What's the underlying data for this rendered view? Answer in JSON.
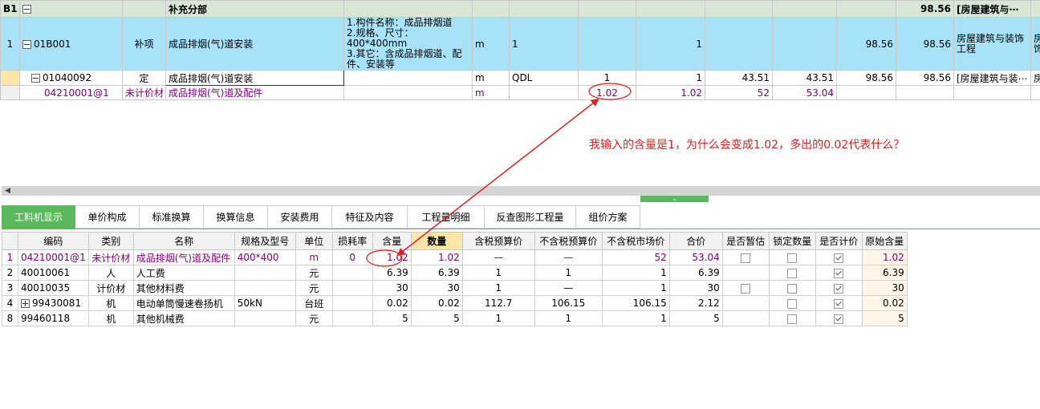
{
  "top": {
    "section_row": {
      "row_label": "B1",
      "name": "补充分部",
      "total": "98.56",
      "major": "[房屋建筑与⋯"
    },
    "rows": [
      {
        "num": "1",
        "code": "01B001",
        "type": "补项",
        "name": "成品排烟(气)道安装",
        "features": "1.构件名称：成品排烟道\n2.规格、尺寸：400*400mm\n3.其它：含成品排烟道、配件、安装等",
        "unit": "m",
        "expr": "1",
        "content": "",
        "qty": "1",
        "price": "",
        "combined": "",
        "unit_price": "98.56",
        "total": "98.56",
        "major": "房屋建筑与装饰工程",
        "extra": "房饰"
      },
      {
        "num": "",
        "code": "01040092",
        "type": "定",
        "name": "成品排烟(气)道安装",
        "features": "",
        "unit": "m",
        "expr": "QDL",
        "content": "1",
        "qty": "1",
        "price": "43.51",
        "combined": "43.51",
        "unit_price": "98.56",
        "total": "98.56",
        "major": "[房屋建筑与装⋯",
        "extra": "房"
      },
      {
        "num": "",
        "code": "04210001@1",
        "type": "未计价材",
        "name": "成品排烟(气)道及配件",
        "features": "",
        "unit": "m",
        "expr": "",
        "content": "1.02",
        "qty": "1.02",
        "price": "52",
        "combined": "53.04",
        "unit_price": "",
        "total": "",
        "major": "",
        "extra": ""
      }
    ]
  },
  "annotation": "我输入的含量是1，为什么会变成1.02，多出的0.02代表什么？",
  "tabs": [
    "工料机显示",
    "单价构成",
    "标准换算",
    "换算信息",
    "安装费用",
    "特征及内容",
    "工程量明细",
    "反查图形工程量",
    "组价方案"
  ],
  "bottom": {
    "headers": [
      "",
      "编码",
      "类别",
      "名称",
      "规格及型号",
      "单位",
      "损耗率",
      "含量",
      "数量",
      "含税预算价",
      "不含税预算价",
      "不含税市场价",
      "合价",
      "是否暂估",
      "锁定数量",
      "是否计价",
      "原始含量"
    ],
    "rows": [
      {
        "num": "1",
        "code": "04210001@1",
        "type": "未计价材",
        "name": "成品排烟(气)道及配件",
        "spec": "400*400",
        "unit": "m",
        "loss": "0",
        "content": "1.02",
        "qty": "1.02",
        "p1": "—",
        "p2": "—",
        "p3": "52",
        "total": "53.04",
        "est": true,
        "lock": true,
        "priced": true,
        "orig": "1.02"
      },
      {
        "num": "2",
        "code": "40010061",
        "type": "人",
        "name": "人工费",
        "spec": "",
        "unit": "元",
        "loss": "",
        "content": "6.39",
        "qty": "6.39",
        "p1": "1",
        "p2": "1",
        "p3": "1",
        "total": "6.39",
        "est": false,
        "lock": true,
        "priced": true,
        "orig": "6.39"
      },
      {
        "num": "3",
        "code": "40010035",
        "type": "计价材",
        "name": "其他材料费",
        "spec": "",
        "unit": "元",
        "loss": "",
        "content": "30",
        "qty": "30",
        "p1": "1",
        "p2": "—",
        "p3": "1",
        "total": "30",
        "est": true,
        "lock": true,
        "priced": true,
        "orig": "30"
      },
      {
        "num": "4",
        "code": "99430081",
        "type": "机",
        "name": "电动单筒慢速卷扬机",
        "spec": "50kN",
        "unit": "台班",
        "loss": "",
        "content": "0.02",
        "qty": "0.02",
        "p1": "112.7",
        "p2": "106.15",
        "p3": "106.15",
        "total": "2.12",
        "est": false,
        "lock": true,
        "priced": true,
        "orig": "0.02"
      },
      {
        "num": "8",
        "code": "99460118",
        "type": "机",
        "name": "其他机械费",
        "spec": "",
        "unit": "元",
        "loss": "",
        "content": "5",
        "qty": "5",
        "p1": "1",
        "p2": "1",
        "p3": "1",
        "total": "5",
        "est": false,
        "lock": true,
        "priced": true,
        "orig": "5"
      }
    ]
  },
  "colors": {
    "accent": "#5cb85c",
    "annotation": "#e02020",
    "material_text": "#80007c",
    "selected_row_bg": "#a8e2f8"
  }
}
